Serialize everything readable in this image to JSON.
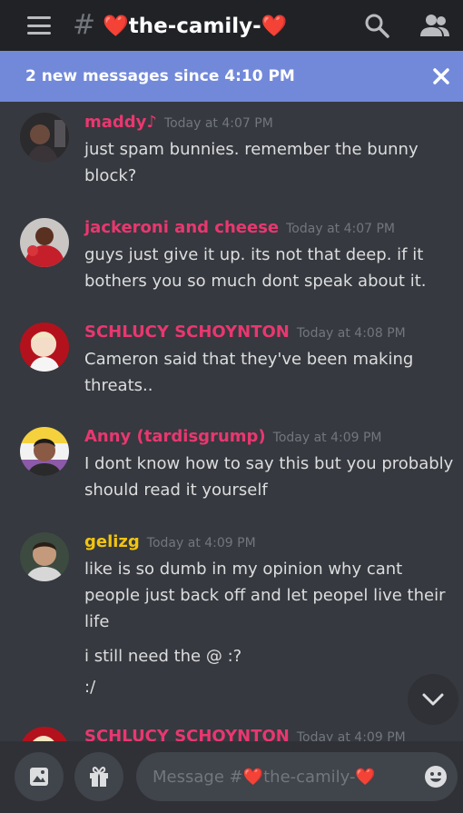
{
  "channel": {
    "hash": "#",
    "name": "❤️the-camily-❤️"
  },
  "banner": {
    "text": "2 new messages since 4:10 PM",
    "close_icon": "close-icon"
  },
  "messages": [
    {
      "author": "maddy♪",
      "author_color": "#e9376f",
      "time": "Today at 4:07 PM",
      "lines": [
        "just spam bunnies. remember the bunny",
        "block?"
      ]
    },
    {
      "author": "jackeroni and cheese",
      "author_color": "#e9376f",
      "time": "Today at 4:07 PM",
      "lines": [
        "guys just give it up. its not that deep. if it",
        "bothers you so much dont speak about it."
      ]
    },
    {
      "author": "SCHLUCY SCHOYNTON",
      "author_color": "#e9376f",
      "time": "Today at 4:08 PM",
      "lines": [
        "Cameron said that they've been making",
        "threats.."
      ]
    },
    {
      "author": "Anny  (tardisgrump)",
      "author_color": "#e9376f",
      "time": "Today at 4:09 PM",
      "lines": [
        "I dont know how to say this but you probably",
        "should read it yourself"
      ]
    },
    {
      "author": "gelizg",
      "author_color": "#f1c40f",
      "time": "Today at 4:09 PM",
      "lines": [
        "like is so dumb in my opinion why cant",
        "people just back off and let peopel live their",
        "life"
      ],
      "extra_lines": [
        "i still need the @ :?",
        ":/"
      ]
    },
    {
      "author": "SCHLUCY SCHOYNTON",
      "author_color": "#e9376f",
      "time": "Today at 4:09 PM",
      "lines": []
    }
  ],
  "composer": {
    "placeholder": "Message #❤️the-camily-❤️"
  },
  "icons": {
    "menu": "hamburger-menu-icon",
    "search": "search-icon",
    "members": "members-icon",
    "image": "image-upload-icon",
    "gift": "gift-icon",
    "emoji": "emoji-icon",
    "scroll": "chevron-down-icon"
  }
}
